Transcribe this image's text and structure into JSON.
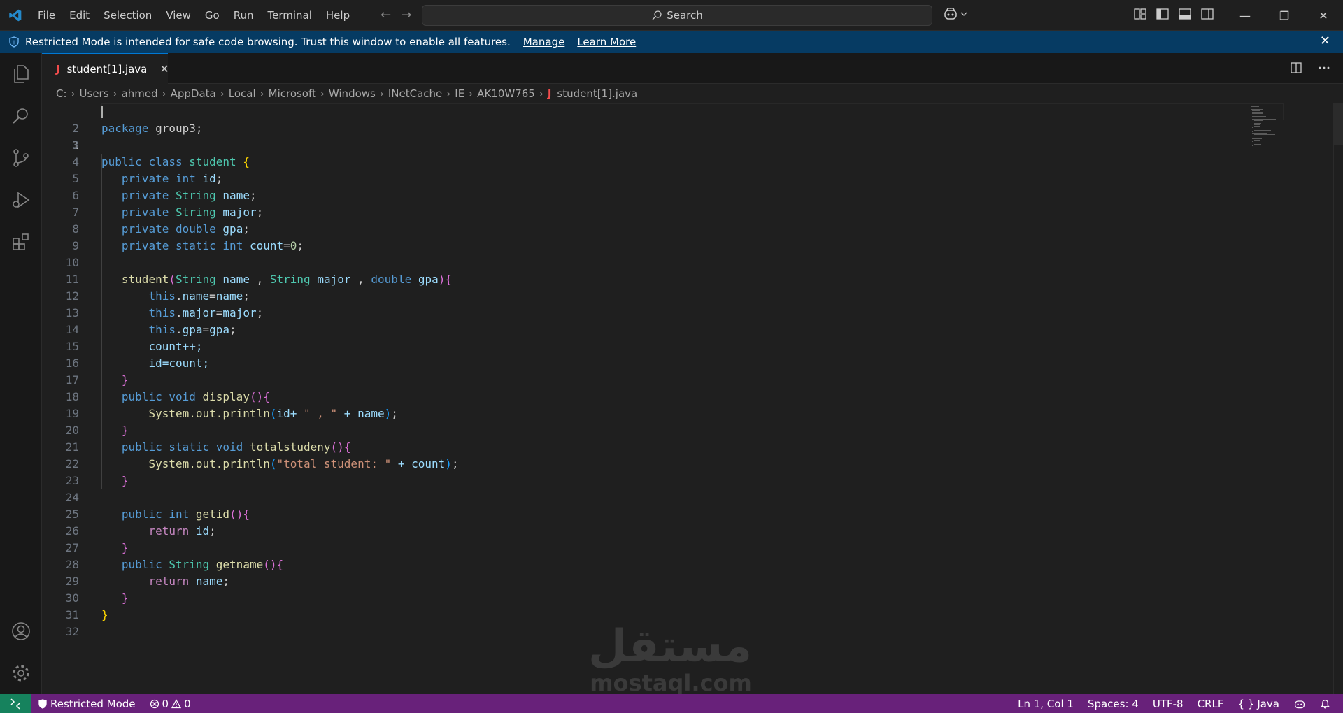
{
  "menu": [
    "File",
    "Edit",
    "Selection",
    "View",
    "Go",
    "Run",
    "Terminal",
    "Help"
  ],
  "search": {
    "label": "Search"
  },
  "banner": {
    "message": "Restricted Mode is intended for safe code browsing. Trust this window to enable all features.",
    "manage_label": "Manage",
    "learn_more_label": "Learn More"
  },
  "tab": {
    "filename": "student[1].java",
    "icon_letter": "J"
  },
  "breadcrumb": [
    "C:",
    "Users",
    "ahmed",
    "AppData",
    "Local",
    "Microsoft",
    "Windows",
    "INetCache",
    "IE",
    "AK10W765",
    "student[1].java"
  ],
  "line_numbers": [
    "1",
    "2",
    "3",
    "4",
    "5",
    "6",
    "7",
    "8",
    "9",
    "10",
    "11",
    "12",
    "13",
    "14",
    "15",
    "16",
    "17",
    "18",
    "19",
    "20",
    "21",
    "22",
    "23",
    "24",
    "25",
    "26",
    "27",
    "28",
    "29",
    "30",
    "31",
    "32"
  ],
  "code": {
    "l2_kw": "package",
    "l2_rest": " group3;",
    "l4_kw1": "public",
    "l4_kw2": "class",
    "l4_name": "student",
    "f_private": "private",
    "t_int": "int",
    "t_String": "String",
    "t_double": "double",
    "t_static": "static",
    "v_id": "id",
    "v_name": "name",
    "v_major": "major",
    "v_gpa": "gpa",
    "v_count": "count",
    "l9_init": "=",
    "l9_num": "0",
    "l11_fn": "student",
    "this": "this",
    "l15": "count++;",
    "l16": "id=count;",
    "kw_public": "public",
    "kw_void": "void",
    "fn_display": "display",
    "fn_total": "totalstudeny",
    "fn_getid": "getid",
    "fn_getname": "getname",
    "sysout": "System.out.println",
    "l19_mid": "id+ ",
    "l19_str": "\" , \"",
    "l19_end": " + name",
    "l22_str": "\"total student: \"",
    "l22_end": " + count",
    "kw_return": "return"
  },
  "watermark": {
    "arabic": "مستقل",
    "latin": "mostaql.com"
  },
  "status": {
    "restricted": "Restricted Mode",
    "errors": "0",
    "warnings": "0",
    "position": "Ln 1, Col 1",
    "spaces": "Spaces: 4",
    "encoding": "UTF-8",
    "eol": "CRLF",
    "language": "Java"
  },
  "colors": {
    "status_bar": "#68217a",
    "banner": "#063b63",
    "remote": "#16825d",
    "java_icon": "#f14c4c"
  }
}
